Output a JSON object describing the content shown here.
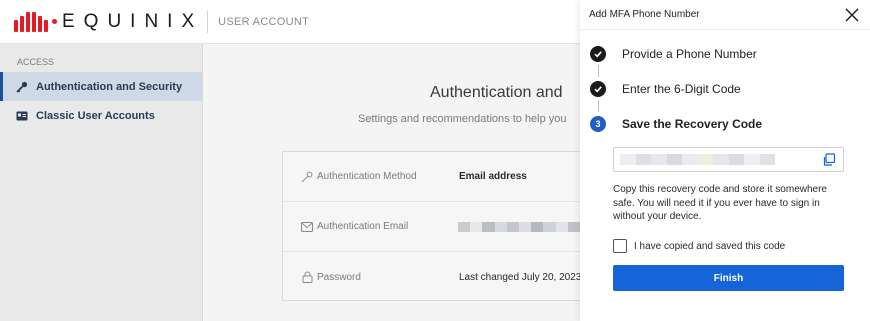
{
  "header": {
    "brand": "EQUINIX",
    "section": "USER ACCOUNT",
    "brand_color": "#e51b24"
  },
  "sidebar": {
    "group_label": "ACCESS",
    "items": [
      {
        "label": "Authentication and Security",
        "icon": "key-icon",
        "active": true
      },
      {
        "label": "Classic User Accounts",
        "icon": "id-card-icon",
        "active": false
      }
    ]
  },
  "main": {
    "title": "Authentication and",
    "subtitle": "Settings and recommendations to help you",
    "rows": [
      {
        "label": "Authentication Method",
        "value": "Email address",
        "icon": "key-icon"
      },
      {
        "label": "Authentication Email",
        "value": "",
        "icon": "envelope-icon"
      },
      {
        "label": "Password",
        "value": "Last changed July 20, 2023",
        "icon": "lock-icon"
      }
    ]
  },
  "drawer": {
    "title": "Add MFA Phone Number",
    "steps": [
      {
        "label": "Provide a Phone Number",
        "status": "done"
      },
      {
        "label": "Enter the 6-Digit Code",
        "status": "done"
      },
      {
        "label": "Save the Recovery Code",
        "status": "current",
        "number": "3"
      }
    ],
    "instructions": "Copy this recovery code and store it somewhere safe. You will need it if you ever have to sign in without your device.",
    "confirm_label": "I have copied and saved this code",
    "finish_label": "Finish",
    "accent_color": "#1565d8"
  }
}
